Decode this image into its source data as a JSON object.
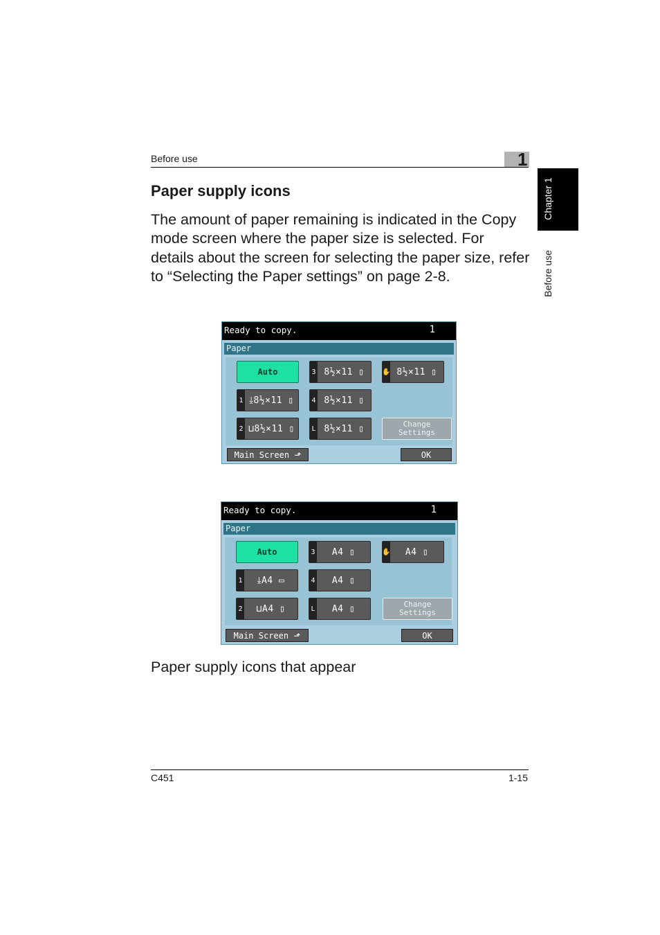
{
  "header": {
    "running_head": "Before use",
    "chapter_number": "1"
  },
  "side_tab": {
    "chapter": "Chapter 1",
    "section": "Before use"
  },
  "section": {
    "title": "Paper supply icons",
    "body": "The amount of paper remaining is indicated in the Copy mode screen where the paper size is selected. For details about the screen for selecting the paper size, refer to “Selecting the Paper settings” on page 2-8."
  },
  "screens": [
    {
      "status": "Ready to copy.",
      "count": "1",
      "title": "Paper",
      "auto": "Auto",
      "trays": [
        {
          "tab": "3",
          "label": "8½×11 ▯"
        },
        {
          "tab": "✋",
          "label": "8½×11 ▯"
        },
        {
          "tab": "1",
          "label": "⤓8½×11 ▯"
        },
        {
          "tab": "4",
          "label": "8½×11 ▯"
        },
        {
          "tab": "2",
          "label": "⊔8½×11 ▯"
        },
        {
          "tab": "L",
          "label": "8½×11 ▯"
        }
      ],
      "change_settings": "Change Settings",
      "main_screen": "Main Screen ⬏",
      "ok": "OK"
    },
    {
      "status": "Ready to copy.",
      "count": "1",
      "title": "Paper",
      "auto": "Auto",
      "trays": [
        {
          "tab": "3",
          "label": "A4 ▯"
        },
        {
          "tab": "✋",
          "label": "A4 ▯"
        },
        {
          "tab": "1",
          "label": "⤓A4 ▭"
        },
        {
          "tab": "4",
          "label": "A4 ▯"
        },
        {
          "tab": "2",
          "label": "⊔A4 ▯"
        },
        {
          "tab": "L",
          "label": "A4 ▯"
        }
      ],
      "change_settings": "Change Settings",
      "main_screen": "Main Screen ⬏",
      "ok": "OK"
    }
  ],
  "caption": "Paper supply icons that appear",
  "footer": {
    "model": "C451",
    "page": "1-15"
  }
}
